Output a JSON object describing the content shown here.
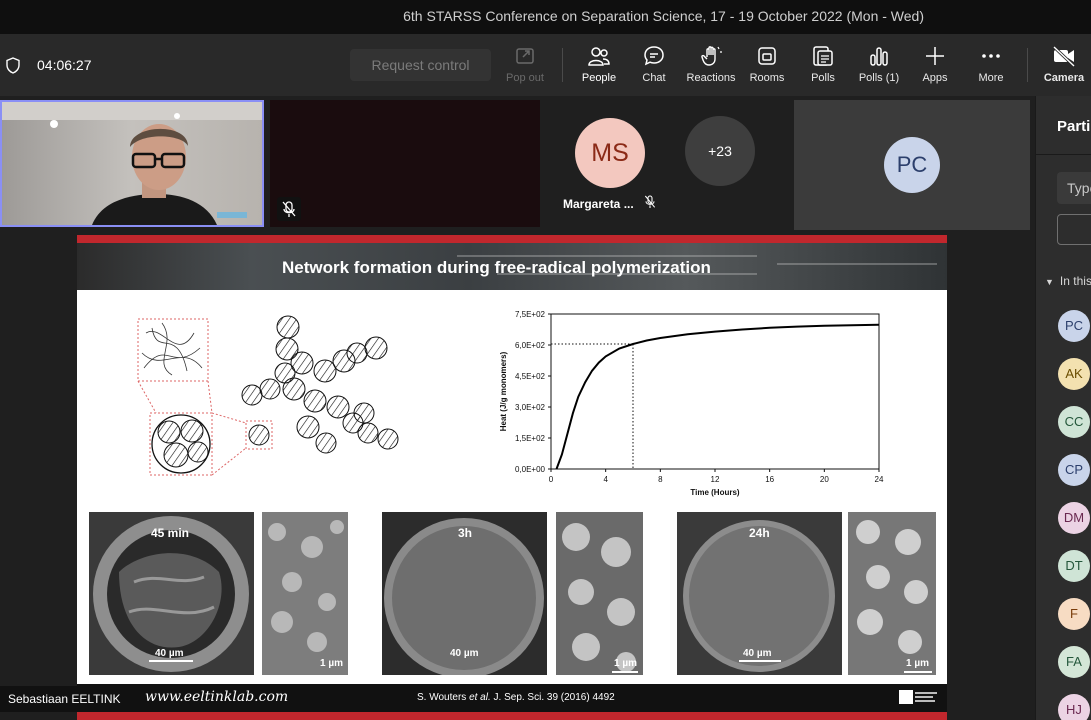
{
  "window": {
    "title": "6th STARSS Conference on Separation Science, 17 - 19 October 2022 (Mon - Wed)"
  },
  "toolbar": {
    "timer": "04:06:27",
    "request_control": "Request control",
    "buttons": [
      {
        "label": "Pop out",
        "icon": "pop-out-icon"
      },
      {
        "label": "People",
        "icon": "people-icon"
      },
      {
        "label": "Chat",
        "icon": "chat-icon"
      },
      {
        "label": "Reactions",
        "icon": "reactions-icon"
      },
      {
        "label": "Rooms",
        "icon": "rooms-icon"
      },
      {
        "label": "Polls",
        "icon": "polls-icon"
      },
      {
        "label": "Polls (1)",
        "icon": "polls-chart-icon"
      },
      {
        "label": "Apps",
        "icon": "plus-icon"
      },
      {
        "label": "More",
        "icon": "more-icon"
      },
      {
        "label": "Camera",
        "icon": "camera-off-icon"
      }
    ]
  },
  "participants_strip": {
    "avatar_ms": {
      "initials": "MS",
      "name": "Margareta ..."
    },
    "overflow": "+23",
    "avatar_pc": "PC"
  },
  "panel": {
    "heading": "Parti",
    "search_placeholder": "Type",
    "section": "In this",
    "avatars": [
      {
        "initials": "PC",
        "bg": "#c9d4ea",
        "fg": "#2c3f6c"
      },
      {
        "initials": "AK",
        "bg": "#f3e1b0",
        "fg": "#6a4d00"
      },
      {
        "initials": "CC",
        "bg": "#cfe4d6",
        "fg": "#24573b"
      },
      {
        "initials": "CP",
        "bg": "#c9d4ea",
        "fg": "#2c3f6c"
      },
      {
        "initials": "DM",
        "bg": "#ecd3e4",
        "fg": "#6a2850"
      },
      {
        "initials": "DT",
        "bg": "#cfe4d6",
        "fg": "#24573b"
      },
      {
        "initials": "F",
        "bg": "#f7dcc3",
        "fg": "#7a3d0a"
      },
      {
        "initials": "FA",
        "bg": "#d4e6d7",
        "fg": "#24573b"
      },
      {
        "initials": "HJ",
        "bg": "#ecd3e4",
        "fg": "#6a2850"
      }
    ]
  },
  "slide": {
    "title": "Network formation during free-radical polymerization",
    "citation_author": "S. Wouters ",
    "citation_etal": "et al.",
    "citation_rest": " J. Sep. Sci. 39 (2016) 4492",
    "url": "www.eeltinklab.com",
    "sem": [
      {
        "label": "45 min",
        "scale": "40 µm",
        "zoom_scale": "1 µm"
      },
      {
        "label": "3h",
        "scale": "40 µm",
        "zoom_scale": "1 µm"
      },
      {
        "label": "24h",
        "scale": "40 µm",
        "zoom_scale": "1 µm"
      }
    ]
  },
  "chart_data": {
    "type": "line",
    "title": "",
    "xlabel": "Time (Hours)",
    "ylabel": "Heat (J/g monomers)",
    "xlim": [
      0,
      24
    ],
    "ylim": [
      0,
      750
    ],
    "xticks": [
      "0",
      "4",
      "8",
      "12",
      "16",
      "20",
      "24"
    ],
    "yticks": [
      "0,0E+00",
      "1,5E+02",
      "3,0E+02",
      "4,5E+02",
      "6,0E+02",
      "7,5E+02"
    ],
    "series": [
      {
        "x": [
          0.4,
          0.8,
          1.2,
          1.6,
          2,
          2.5,
          3,
          3.5,
          4,
          5,
          6,
          7,
          8,
          10,
          12,
          14,
          16,
          18,
          20,
          22,
          24
        ],
        "values": [
          0,
          70,
          170,
          270,
          350,
          420,
          475,
          515,
          545,
          583,
          605,
          622,
          634,
          652,
          665,
          675,
          683,
          689,
          693,
          696,
          698
        ]
      }
    ],
    "marker": {
      "x": 6,
      "y": 605
    }
  },
  "presenter": {
    "name": "Sebastiaan EELTINK"
  }
}
